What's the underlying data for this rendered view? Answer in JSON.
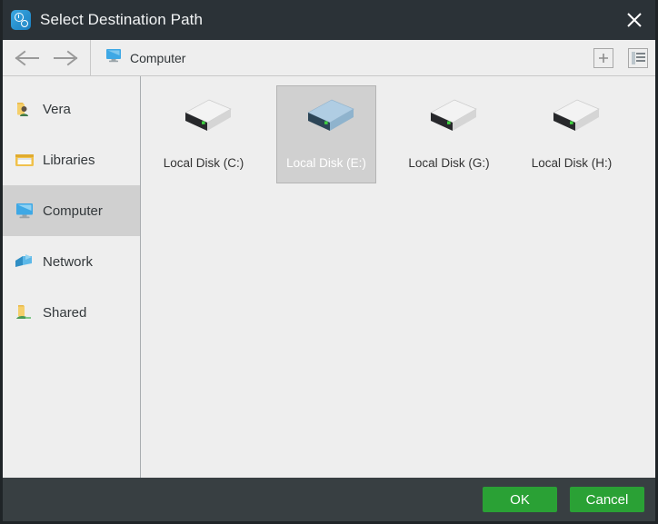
{
  "window": {
    "title": "Select Destination Path",
    "app_icon": "clock-gear-icon",
    "close_icon": "close-icon",
    "titlebar_color": "#2b3237",
    "footer_color": "#383f42",
    "accent_color": "#2aa135"
  },
  "toolbar": {
    "back_icon": "arrow-left-icon",
    "forward_icon": "arrow-right-icon",
    "breadcrumb_icon": "computer-monitor-icon",
    "breadcrumb_label": "Computer",
    "new_folder_icon": "plus-icon",
    "view_list_icon": "list-view-icon"
  },
  "sidebar": {
    "items": [
      {
        "label": "Vera",
        "icon": "user-folder-icon",
        "selected": false
      },
      {
        "label": "Libraries",
        "icon": "libraries-folder-icon",
        "selected": false
      },
      {
        "label": "Computer",
        "icon": "computer-monitor-icon",
        "selected": true
      },
      {
        "label": "Network",
        "icon": "network-icon",
        "selected": false
      },
      {
        "label": "Shared",
        "icon": "shared-folder-icon",
        "selected": false
      }
    ]
  },
  "content": {
    "drives": [
      {
        "label": "Local Disk (C:)",
        "icon": "hard-disk-icon",
        "selected": false
      },
      {
        "label": "Local Disk (E:)",
        "icon": "hard-disk-icon",
        "selected": true
      },
      {
        "label": "Local Disk (G:)",
        "icon": "hard-disk-icon",
        "selected": false
      },
      {
        "label": "Local Disk (H:)",
        "icon": "hard-disk-icon",
        "selected": false
      }
    ]
  },
  "footer": {
    "ok_label": "OK",
    "cancel_label": "Cancel"
  }
}
